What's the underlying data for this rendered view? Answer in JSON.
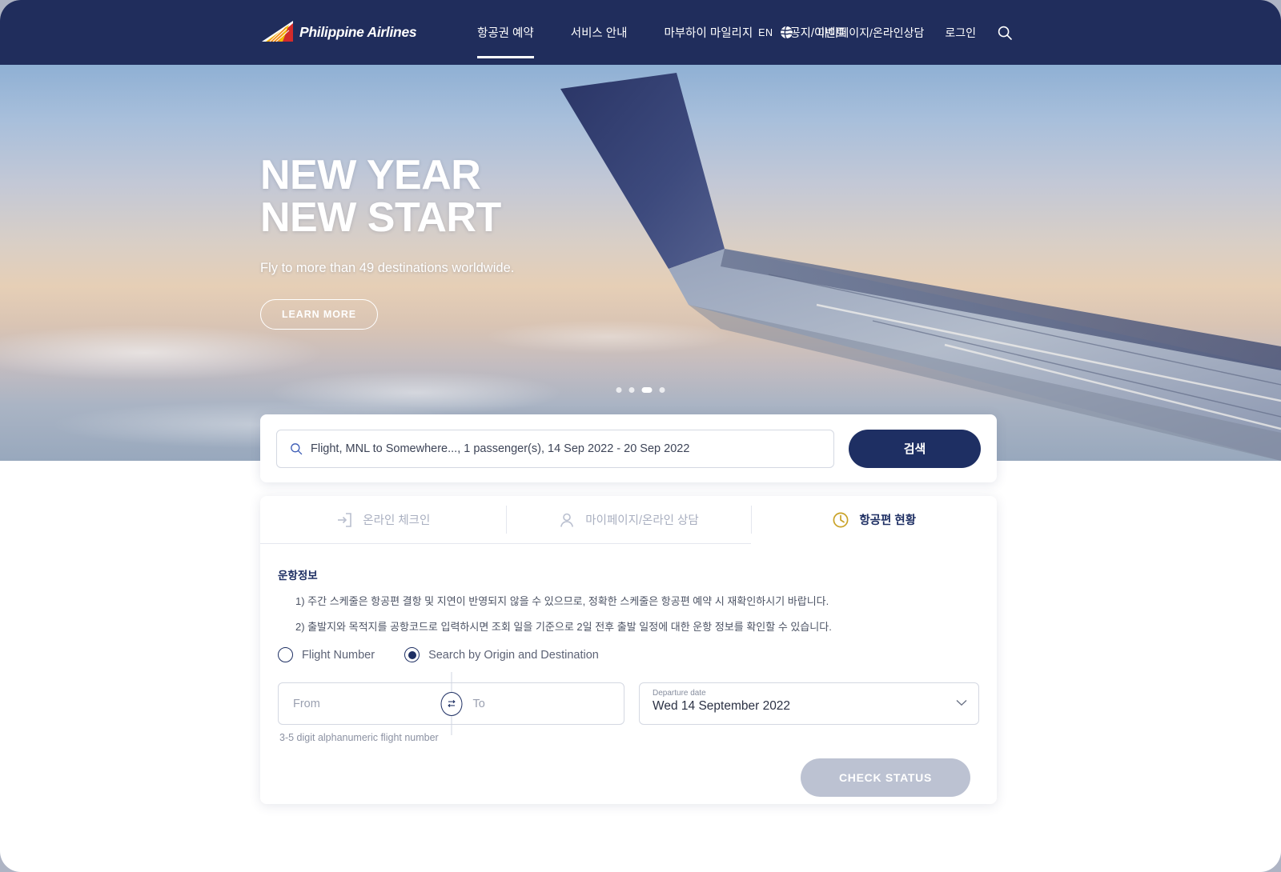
{
  "header": {
    "brand": "Philippine Airlines",
    "nav": [
      {
        "label": "항공권 예약",
        "active": true
      },
      {
        "label": "서비스 안내",
        "active": false
      },
      {
        "label": "마부하이 마일리지",
        "active": false
      },
      {
        "label": "공지/이벤트",
        "active": false
      }
    ],
    "language": "EN",
    "mypage_link": "마이페이지/온라인상담",
    "login_link": "로그인",
    "icons": {
      "globe": "globe-icon",
      "search": "search-icon"
    },
    "bg_color": "#202d5c"
  },
  "hero": {
    "title_line1": "NEW YEAR",
    "title_line2": "NEW START",
    "subtitle": "Fly to more than 49 destinations worldwide.",
    "cta": "LEARN MORE",
    "carousel": {
      "count": 4,
      "active_index": 2
    }
  },
  "search": {
    "value": "Flight, MNL to Somewhere..., 1 passenger(s), 14 Sep 2022 - 20 Sep 2022",
    "placeholder": "Flight, MNL to Somewhere..., 1 passenger(s), 14 Sep 2022 - 20 Sep 2022",
    "button_label": "검색",
    "button_color": "#1e2f63"
  },
  "panel": {
    "tabs": [
      {
        "label": "온라인 체크인",
        "icon": "check-in-icon",
        "active": false
      },
      {
        "label": "마이페이지/온라인 상담",
        "icon": "user-icon",
        "active": false
      },
      {
        "label": "항공편 현황",
        "icon": "clock-icon",
        "active": true
      }
    ],
    "active_tab_color": "#c9a227",
    "section_title": "운항정보",
    "notices": [
      "1) 주간 스케줄은 항공편 결항 및 지연이 반영되지 않을 수 있으므로, 정확한 스케줄은 항공편 예약 시 재확인하시기 바랍니다.",
      "2) 출발지와 목적지를 공항코드로 입력하시면 조회 일을 기준으로 2일 전후 출발 일정에 대한 운항 정보를 확인할 수 있습니다."
    ],
    "radios": [
      {
        "label": "Flight Number",
        "selected": false
      },
      {
        "label": "Search by Origin and Destination",
        "selected": true
      }
    ],
    "from_placeholder": "From",
    "to_placeholder": "To",
    "swap_icon": "swap-arrows-icon",
    "date_label": "Departure date",
    "date_value": "Wed 14 September 2022",
    "helper_text": "3-5 digit alphanumeric flight number",
    "submit_label": "CHECK STATUS",
    "submit_disabled": true
  }
}
